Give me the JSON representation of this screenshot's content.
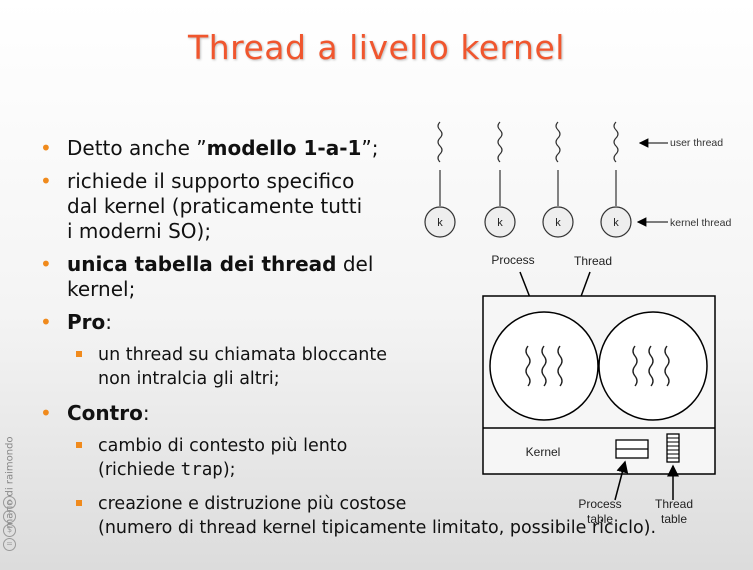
{
  "title": "Thread a livello kernel",
  "bullets": [
    {
      "pre": "Detto anche ”",
      "bold": "modello 1-a-1",
      "post": "”;"
    },
    {
      "line1": "richiede il supporto specifico",
      "line2": "dal kernel (praticamente tutti",
      "line3": "i moderni SO);"
    },
    {
      "bold": "unica tabella dei thread",
      "post": " del",
      "line2": "kernel;"
    },
    {
      "bold": "Pro",
      "post": ":"
    },
    {
      "line1": "un thread su chiamata bloccante",
      "line2": "non intralcia gli altri;"
    },
    {
      "bold": "Contro",
      "post": ":"
    },
    {
      "line1": "cambio di contesto più lento",
      "pre2": "(richiede ",
      "mono": "trap",
      "post2": ");"
    },
    {
      "line1": "creazione e distruzione più costose",
      "line2": "(numero di thread kernel tipicamente limitato, possibile riciclo)."
    }
  ],
  "sidebar": {
    "author": "mario di raimondo"
  },
  "figure": {
    "user_thread_label": "user thread",
    "kernel_thread_label": "kernel thread",
    "k_label": "k",
    "process_label": "Process",
    "thread_label": "Thread",
    "kernel_label": "Kernel",
    "process_table_label": [
      "Process",
      "table"
    ],
    "thread_table_label": [
      "Thread",
      "table"
    ]
  },
  "colors": {
    "title": "#f0562e",
    "bullet": "#f08a1c"
  }
}
